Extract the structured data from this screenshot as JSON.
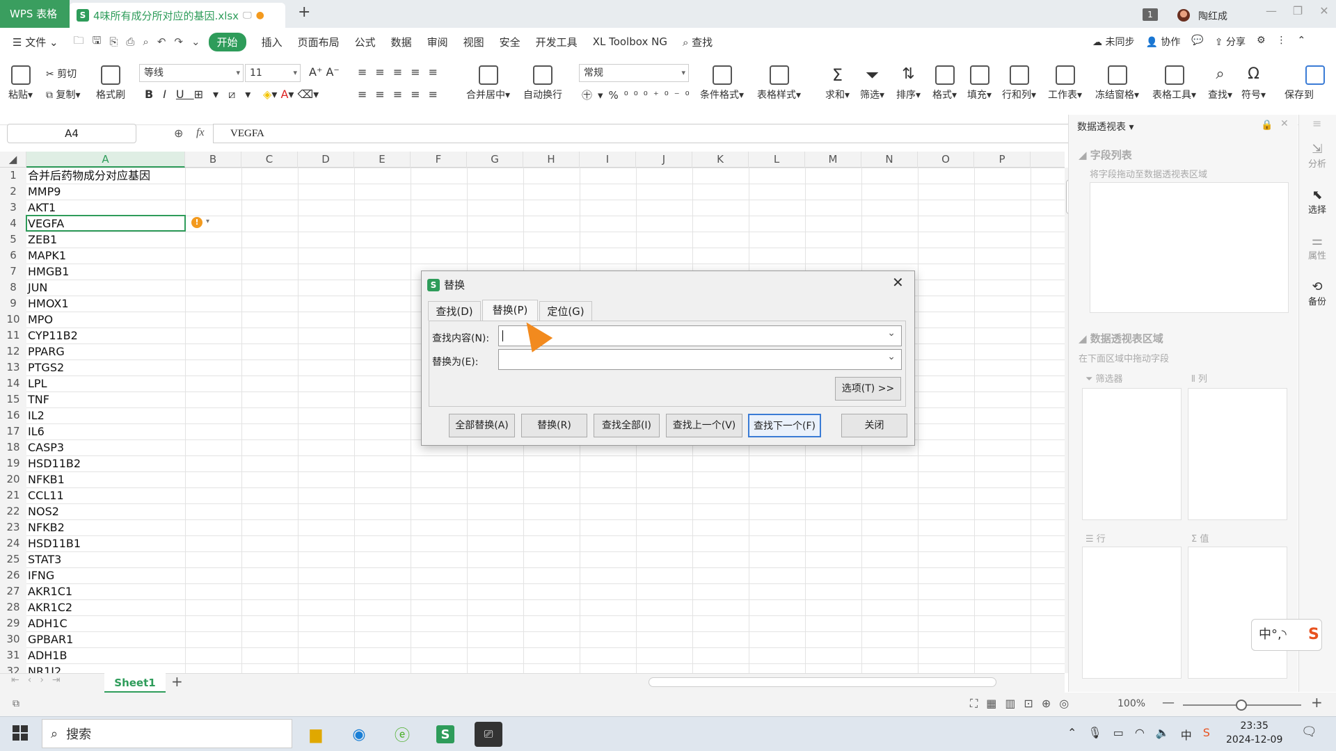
{
  "titlebar": {
    "app_label": "WPS 表格",
    "doc_title": "4味所有成分所对应的基因.xlsx",
    "new_tab": "+",
    "badge": "1",
    "user": "陶红成"
  },
  "menu": {
    "file": "文件",
    "items": [
      "开始",
      "插入",
      "页面布局",
      "公式",
      "数据",
      "审阅",
      "视图",
      "安全",
      "开发工具",
      "XL Toolbox NG"
    ],
    "search": "查找",
    "right": [
      "未同步",
      "协作",
      "分享"
    ]
  },
  "ribbon": {
    "paste": "粘贴",
    "cut": "剪切",
    "copy": "复制",
    "format_painter": "格式刷",
    "font": "等线",
    "size": "11",
    "merge": "合并居中",
    "wrap": "自动换行",
    "numfmt": "常规",
    "groups": [
      "条件格式",
      "表格样式",
      "求和",
      "筛选",
      "排序",
      "格式",
      "填充",
      "行和列",
      "工作表",
      "冻结窗格",
      "表格工具",
      "查找",
      "符号",
      "保存到"
    ]
  },
  "formula": {
    "namebox": "A4",
    "fx": "fx",
    "value": "VEGFA"
  },
  "columns": [
    "A",
    "B",
    "C",
    "D",
    "E",
    "F",
    "G",
    "H",
    "I",
    "J",
    "K",
    "L",
    "M",
    "N",
    "O",
    "P"
  ],
  "cells": [
    "合并后药物成分对应基因",
    "MMP9",
    "AKT1",
    " VEGFA",
    " ZEB1",
    " MAPK1",
    "HMGB1",
    " JUN",
    " HMOX1",
    " MPO",
    "CYP11B2",
    "PPARG",
    " PTGS2",
    " LPL",
    " TNF",
    " IL2",
    " IL6",
    " CASP3",
    " HSD11B2",
    " NFKB1",
    " CCL11",
    " NOS2",
    " NFKB2",
    " HSD11B1",
    " STAT3",
    "IFNG",
    " AKR1C1",
    " AKR1C2",
    " ADH1C",
    " GPBAR1",
    " ADH1B",
    " NR1I2"
  ],
  "sheet": {
    "tab": "Sheet1",
    "zoom": "100%"
  },
  "pane": {
    "title": "数据透视表",
    "fields": "字段列表",
    "fields_hint": "将字段拖动至数据透视表区域",
    "area": "数据透视表区域",
    "area_hint": "在下面区域中拖动字段",
    "filter": "筛选器",
    "col": "列",
    "row": "行",
    "val": "值"
  },
  "sidebar": [
    "分析",
    "选择",
    "属性",
    "备份"
  ],
  "dialog": {
    "title": "替换",
    "tabs": [
      "查找(D)",
      "替换(P)",
      "定位(G)"
    ],
    "find_label": "查找内容(N):",
    "replace_label": "替换为(E):",
    "find_value": "",
    "replace_value": "",
    "options": "选项(T) >>",
    "buttons": [
      "全部替换(A)",
      "替换(R)",
      "查找全部(I)",
      "查找上一个(V)",
      "查找下一个(F)",
      "关闭"
    ]
  },
  "ime": "中°,◝",
  "taskbar": {
    "search": "搜索",
    "time": "23:35",
    "date": "2024-12-09"
  },
  "colors": {
    "accent": "#2e9c5a",
    "warn": "#f39a1e"
  }
}
